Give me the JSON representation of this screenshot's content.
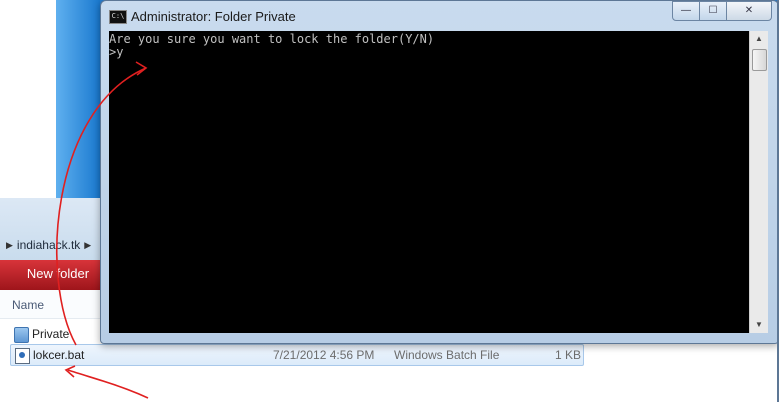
{
  "console_window": {
    "title": "Administrator:  Folder Private",
    "icon_label": "C:\\",
    "lines": [
      "Are you sure you want to lock the folder(Y/N)",
      ">y"
    ],
    "controls": {
      "minimize": "—",
      "maximize": "☐",
      "close": "✕"
    }
  },
  "explorer": {
    "breadcrumb": "indiahack.tk",
    "toolbar": {
      "new_folder": "New folder"
    },
    "columns": {
      "name": "Name"
    },
    "files": [
      {
        "name": "Private",
        "icon": "folder-icon",
        "date": "",
        "type": "",
        "size": ""
      },
      {
        "name": "lokcer.bat",
        "icon": "batch-file-icon",
        "date": "7/21/2012 4:56 PM",
        "type": "Windows Batch File",
        "size": "1 KB"
      }
    ]
  },
  "annotation_color": "#e02020"
}
